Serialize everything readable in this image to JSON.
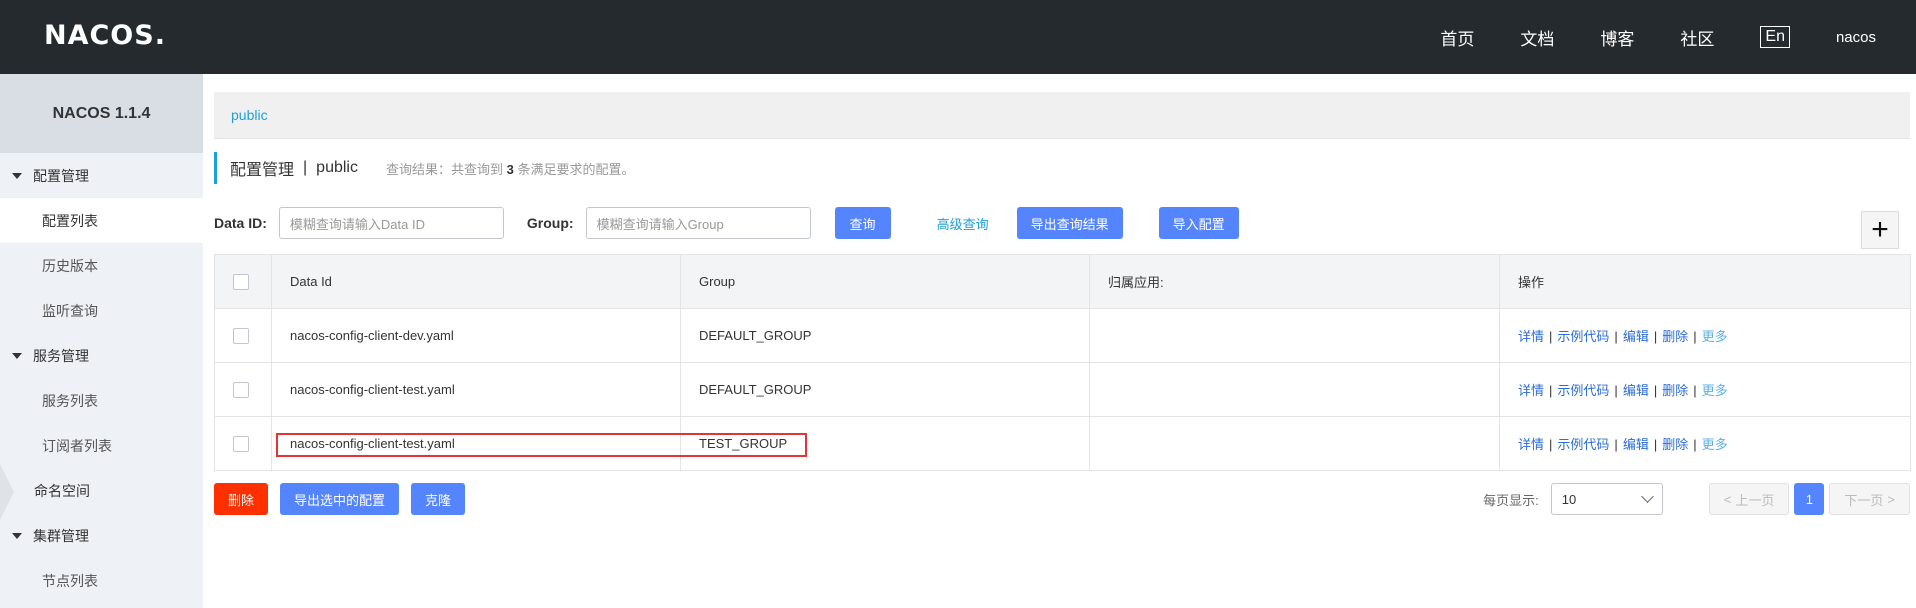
{
  "app": {
    "logo_text": "NACOS.",
    "nav": [
      "首页",
      "文档",
      "博客",
      "社区"
    ],
    "lang_toggle": "En",
    "user": "nacos"
  },
  "sidebar": {
    "version": "NACOS 1.1.4",
    "groups": [
      {
        "label": "配置管理",
        "items": [
          "配置列表",
          "历史版本",
          "监听查询"
        ]
      },
      {
        "label": "服务管理",
        "items": [
          "服务列表",
          "订阅者列表"
        ]
      }
    ],
    "namespace": "命名空间",
    "cluster_group": {
      "label": "集群管理",
      "items": [
        "节点列表"
      ]
    }
  },
  "breadcrumb": "public",
  "page_title": {
    "main": "配置管理",
    "separator": "|",
    "namespace": "public",
    "hint_prefix": "查询结果：共查询到",
    "hint_count": "3",
    "hint_suffix": "条满足要求的配置。"
  },
  "filters": {
    "data_id_label": "Data ID:",
    "data_id_placeholder": "模糊查询请输入Data ID",
    "group_label": "Group:",
    "group_placeholder": "模糊查询请输入Group",
    "search_button": "查询",
    "advanced_search": "高级查询",
    "export_results_button": "导出查询结果",
    "import_button": "导入配置",
    "add_icon": "plus-icon"
  },
  "table": {
    "headers": [
      "Data Id",
      "Group",
      "归属应用:",
      "操作"
    ],
    "rows": [
      {
        "data_id": "nacos-config-client-dev.yaml",
        "group": "DEFAULT_GROUP",
        "app": ""
      },
      {
        "data_id": "nacos-config-client-test.yaml",
        "group": "DEFAULT_GROUP",
        "app": ""
      },
      {
        "data_id": "nacos-config-client-test.yaml",
        "group": "TEST_GROUP",
        "app": ""
      }
    ],
    "ops": [
      "详情",
      "示例代码",
      "编辑",
      "删除",
      "更多"
    ]
  },
  "bottom": {
    "delete_button": "删除",
    "export_selected_button": "导出选中的配置",
    "clone_button": "克隆",
    "page_size_label": "每页显示:",
    "page_size": "10",
    "prev": "上一页",
    "current_page": "1",
    "next": "下一页"
  },
  "colors": {
    "primary": "#5584ff",
    "danger": "#ff3000",
    "link": "#20a0d8",
    "topbar": "#252a2f",
    "highlight": "#e63434"
  }
}
